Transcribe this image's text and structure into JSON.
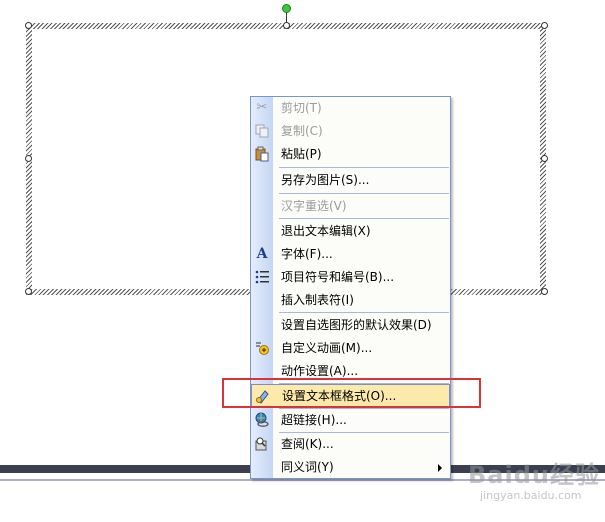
{
  "menu": {
    "items": [
      {
        "label": "剪切(T)",
        "icon": "scissors-icon",
        "disabled": true
      },
      {
        "label": "复制(C)",
        "icon": "copy-icon",
        "disabled": true
      },
      {
        "label": "粘贴(P)",
        "icon": "paste-icon",
        "disabled": false
      },
      {
        "label": "另存为图片(S)...",
        "icon": "",
        "disabled": false
      },
      {
        "label": "汉字重选(V)",
        "icon": "",
        "disabled": true
      },
      {
        "label": "退出文本编辑(X)",
        "icon": "",
        "disabled": false
      },
      {
        "label": "字体(F)...",
        "icon": "font-icon",
        "disabled": false
      },
      {
        "label": "项目符号和编号(B)...",
        "icon": "bullets-icon",
        "disabled": false
      },
      {
        "label": "插入制表符(I)",
        "icon": "",
        "disabled": false
      },
      {
        "label": "设置自选图形的默认效果(D)",
        "icon": "",
        "disabled": false
      },
      {
        "label": "自定义动画(M)...",
        "icon": "custom-animation-icon",
        "disabled": false
      },
      {
        "label": "动作设置(A)...",
        "icon": "",
        "disabled": false
      },
      {
        "label": "设置文本框格式(O)...",
        "icon": "format-textbox-icon",
        "disabled": false,
        "highlighted": true
      },
      {
        "label": "超链接(H)...",
        "icon": "hyperlink-icon",
        "disabled": false
      },
      {
        "label": "查阅(K)...",
        "icon": "lookup-icon",
        "disabled": false
      },
      {
        "label": "同义词(Y)",
        "icon": "",
        "disabled": false,
        "submenu": true
      }
    ]
  },
  "watermark": {
    "logo": "Baidu经验",
    "sub": "jingyan.baidu.com"
  },
  "colors": {
    "highlight": "#fde9a9",
    "annotation": "#d9343b",
    "menu_border": "#7a96c8"
  }
}
